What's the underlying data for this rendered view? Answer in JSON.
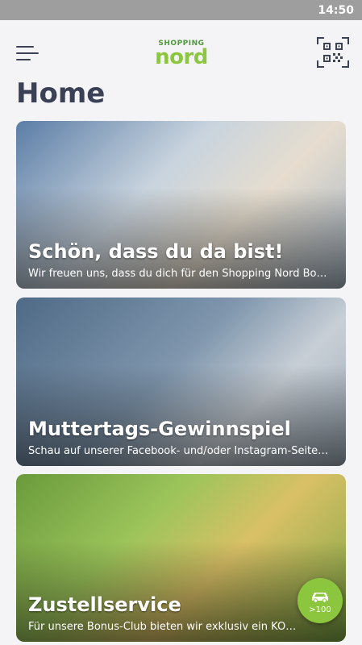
{
  "status_bar": {
    "time": "14:50"
  },
  "app_bar": {
    "logo_top": "SHOPPING",
    "logo_main": "nord",
    "brand_color": "#8cc63f",
    "menu_icon": "hamburger-menu-icon",
    "qr_icon": "qr-code-scanner-icon"
  },
  "page": {
    "title": "Home"
  },
  "cards": [
    {
      "title": "Schön, dass du da bist!",
      "subtitle": "Wir freuen uns, dass du dich für den Shopping Nord Bo…"
    },
    {
      "title": "Muttertags-Gewinnspiel",
      "subtitle": "Schau auf unserer Facebook- und/oder Instagram-Seite…"
    },
    {
      "title": "Zustellservice",
      "subtitle": "Für unsere Bonus-Club bieten wir exklusiv ein KOSTEN…"
    }
  ],
  "fab": {
    "icon": "car-icon",
    "label": ">100"
  }
}
